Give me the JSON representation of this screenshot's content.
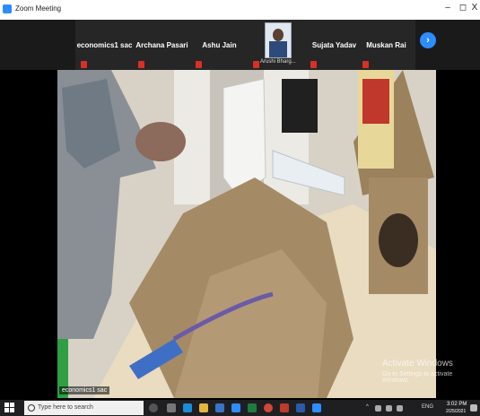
{
  "window": {
    "title": "Zoom Meeting",
    "minimize_glyph": "–",
    "maximize_glyph": "◻",
    "close_glyph": "X"
  },
  "participants": [
    {
      "name": "economics1 sac",
      "muted": true
    },
    {
      "name": "Archana Pasari",
      "muted": true
    },
    {
      "name": "Ashu Jain",
      "muted": true
    },
    {
      "name": "Arushi Bharg...",
      "muted": true,
      "has_photo": true
    },
    {
      "name": "Sujata Yadav",
      "muted": true
    },
    {
      "name": "Muskan Rai",
      "muted": true
    }
  ],
  "next_page_glyph": "›",
  "video": {
    "active_speaker_label": "economics1 sac"
  },
  "activation_watermark": {
    "line1": "Activate Windows",
    "line2": "Go to Settings to activate Windows."
  },
  "taskbar": {
    "search_placeholder": "Type here to search",
    "tray_language": "ENG",
    "clock_time": "3:02 PM",
    "clock_date": "2/25/2021"
  },
  "colors": {
    "zoom_blue": "#2d8cff",
    "mute_red": "#d93025",
    "taskbar_bg": "#1f1f22"
  }
}
